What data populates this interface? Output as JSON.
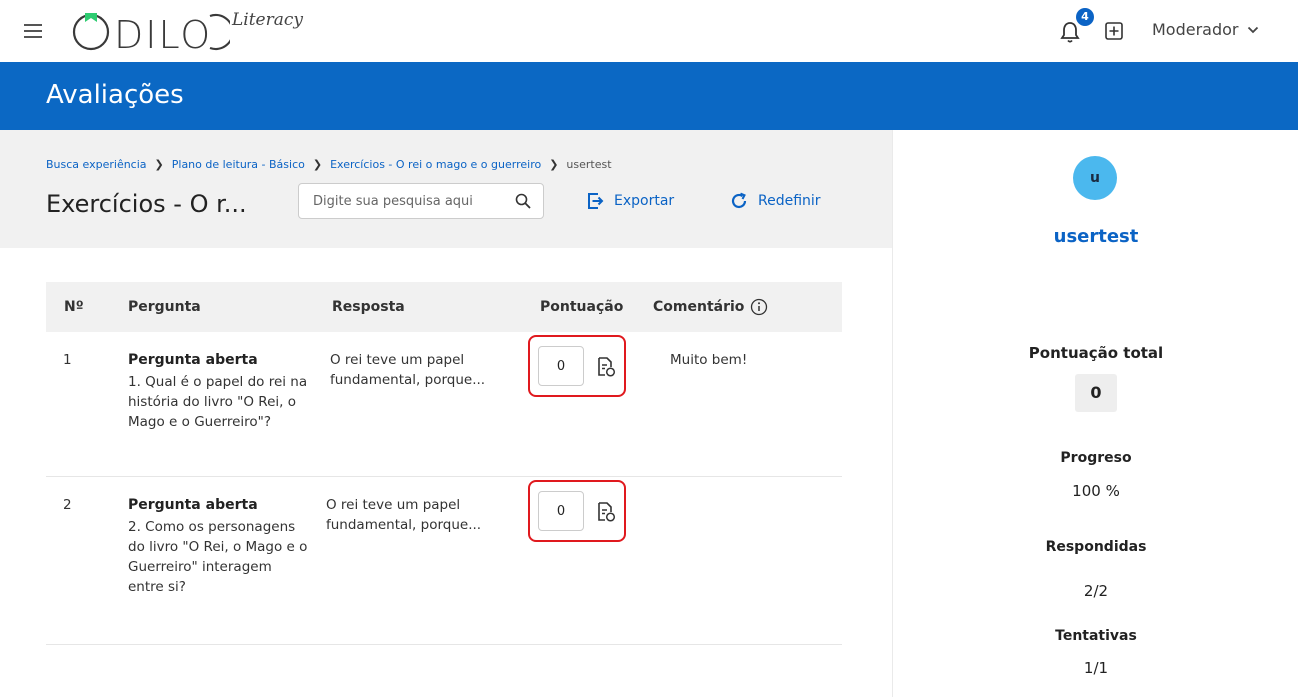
{
  "topbar": {
    "logo_main": "ODILO",
    "logo_sub": "Literacy",
    "notification_count": "4",
    "user_label": "Moderador"
  },
  "hero": {
    "title": "Avaliações"
  },
  "breadcrumb": [
    "Busca experiência",
    "Plano de leitura - Básico",
    "Exercícios - O rei o mago e o guerreiro",
    "usertest"
  ],
  "toolbar": {
    "title": "Exercícios - O r...",
    "search_placeholder": "Digite sua pesquisa aqui",
    "export_label": "Exportar",
    "reset_label": "Redefinir"
  },
  "table": {
    "headers": {
      "num": "Nº",
      "question": "Pergunta",
      "answer": "Resposta",
      "score": "Pontuação",
      "comment": "Comentário"
    },
    "rows": [
      {
        "num": "1",
        "type": "Pergunta aberta",
        "question": "1. Qual é o papel do rei na história do livro \"O Rei, o Mago e o Guerreiro\"?",
        "answer": "O rei teve um papel fundamental, porque...",
        "score": "0",
        "comment": "Muito bem!"
      },
      {
        "num": "2",
        "type": "Pergunta aberta",
        "question": "2. Como os personagens do livro \"O Rei, o Mago e o Guerreiro\" interagem entre si?",
        "answer": "O rei teve um papel fundamental, porque...",
        "score": "0",
        "comment": ""
      }
    ]
  },
  "side": {
    "avatar_letter": "u",
    "username": "usertest",
    "total_label": "Pontuação total",
    "total_value": "0",
    "progress_label": "Progreso",
    "progress_value": "100 %",
    "answered_label": "Respondidas",
    "answered_value": "2/2",
    "attempts_label": "Tentativas",
    "attempts_value": "1/1"
  },
  "colors": {
    "brand_blue": "#0b68c4",
    "link_blue": "#0b63c5",
    "highlight_red": "#e0191e",
    "avatar_blue": "#4bb8ee",
    "logo_green": "#2ecc71"
  }
}
